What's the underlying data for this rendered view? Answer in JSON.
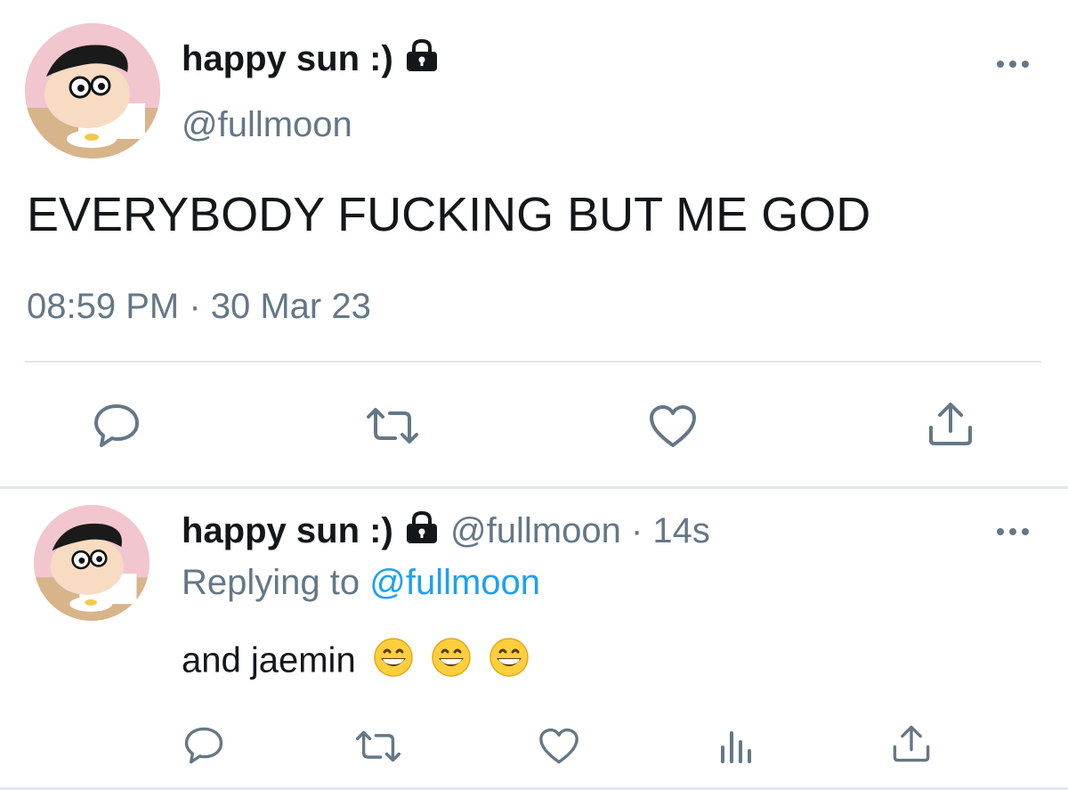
{
  "main_tweet": {
    "display_name": "happy sun :)",
    "handle": "@fullmoon",
    "text": "EVERYBODY FUCKING BUT ME GOD",
    "timestamp": "08:59 PM · 30 Mar 23",
    "actions": [
      "reply-icon",
      "retweet-icon",
      "like-icon",
      "share-icon"
    ]
  },
  "reply_tweet": {
    "display_name": "happy sun :)",
    "handle": "@fullmoon",
    "dot": "·",
    "age": "14s",
    "replying_prefix": "Replying to",
    "replying_handle": "@fullmoon",
    "text": "and jaemin",
    "emoji_count": 3,
    "actions": [
      "reply-icon",
      "retweet-icon",
      "like-icon",
      "analytics-icon",
      "share-icon"
    ]
  },
  "colors": {
    "text_primary": "#14171a",
    "text_secondary": "#657786",
    "link": "#1da1f2",
    "divider": "#e1e8ed",
    "icon": "#657786"
  }
}
